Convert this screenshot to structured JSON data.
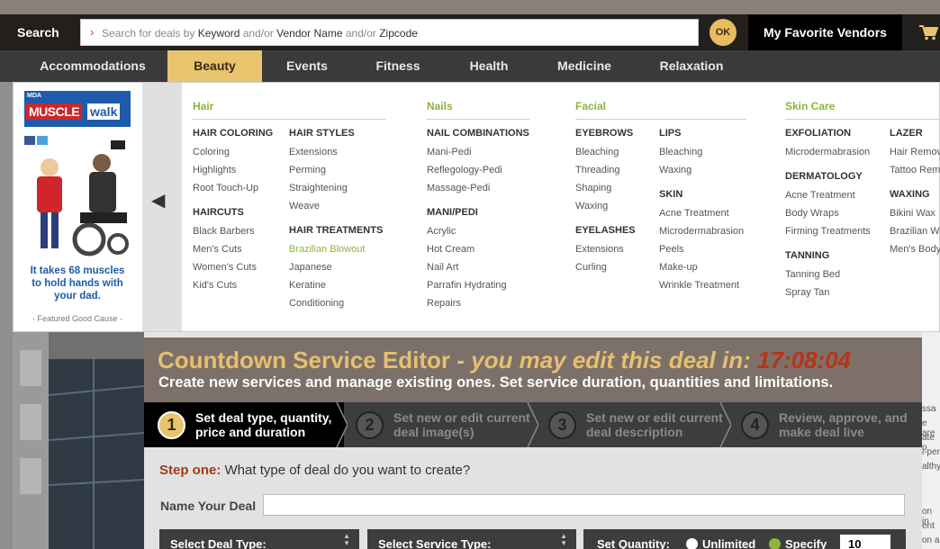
{
  "search": {
    "label": "Search",
    "chevron": "›",
    "placeholder_parts": [
      "Search for deals by ",
      "Keyword",
      " and/or ",
      "Vendor Name",
      " and/or ",
      "Zipcode"
    ],
    "ok_label": "OK",
    "favorites_label": "My Favorite Vendors"
  },
  "nav": {
    "items": [
      {
        "label": "Accommodations",
        "active": false
      },
      {
        "label": "Beauty",
        "active": true
      },
      {
        "label": "Events",
        "active": false
      },
      {
        "label": "Fitness",
        "active": false
      },
      {
        "label": "Health",
        "active": false
      },
      {
        "label": "Medicine",
        "active": false
      },
      {
        "label": "Relaxation",
        "active": false
      }
    ]
  },
  "ad": {
    "org": "MDA",
    "brand_a": "MUSCLE",
    "brand_b": "walk",
    "text": "It takes 68 muscles to hold hands with your dad.",
    "cause": "- Featured Good Cause -"
  },
  "menu": {
    "hair": {
      "title": "Hair",
      "coloring_title": "HAIR COLORING",
      "coloring": [
        "Coloring",
        "Highlights",
        "Root Touch-Up"
      ],
      "haircuts_title": "HAIRCUTS",
      "haircuts": [
        "Black Barbers",
        "Men's Cuts",
        "Women's Cuts",
        "Kid's Cuts"
      ],
      "styles_title": "HAIR STYLES",
      "styles": [
        "Extensions",
        "Perming",
        "Straightening",
        "Weave"
      ],
      "treatments_title": "HAIR TREATMENTS",
      "treatments": [
        "Brazilian Blowout",
        "Japanese",
        "Keratine",
        "Conditioning"
      ]
    },
    "nails": {
      "title": "Nails",
      "combos_title": "NAIL COMBINATIONS",
      "combos": [
        "Mani-Pedi",
        "Reflegology-Pedi",
        "Massage-Pedi"
      ],
      "manipedi_title": "MANI/PEDI",
      "manipedi": [
        "Acrylic",
        "Hot Cream",
        "Nail Art",
        "Parrafin Hydrating",
        "Repairs"
      ]
    },
    "facial": {
      "title": "Facial",
      "eyebrows_title": "EYEBROWS",
      "eyebrows": [
        "Bleaching",
        "Threading",
        "Shaping",
        "Waxing"
      ],
      "eyelashes_title": "EYELASHES",
      "eyelashes": [
        "Extensions",
        "Curling"
      ],
      "lips_title": "LIPS",
      "lips": [
        "Bleaching",
        "Waxing"
      ],
      "skin_title": "SKIN",
      "skin": [
        "Acne Treatment",
        "Microdermabrasion",
        "Peels",
        "Make-up",
        "Wrinkle Treatment"
      ]
    },
    "skincare": {
      "title": "Skin Care",
      "exfoliation_title": "EXFOLIATION",
      "exfoliation": [
        "Microdermabrasion"
      ],
      "derm_title": "DERMATOLOGY",
      "derm": [
        "Acne Treatment",
        "Body Wraps",
        "Firming Treatments"
      ],
      "tanning_title": "TANNING",
      "tanning": [
        "Tanning Bed",
        "Spray Tan"
      ],
      "lazer_title": "LAZER",
      "lazer": [
        "Hair Remov",
        "Tattoo Rem"
      ],
      "waxing_title": "WAXING",
      "waxing": [
        "Bikini Wax",
        "Brazilian W",
        "Men's Body"
      ]
    }
  },
  "editor": {
    "title_a": "Countdown Service Editor - ",
    "title_b": "you may edit this deal in: ",
    "timer": "17:08:04",
    "subtitle": "Create new services and manage existing ones. Set service duration, quantities and limitations.",
    "steps": [
      {
        "num": "1",
        "line1": "Set deal type, quantity,",
        "line2": "price and duration",
        "active": true
      },
      {
        "num": "2",
        "line1": "Set new or edit current",
        "line2": "deal image(s)",
        "active": false
      },
      {
        "num": "3",
        "line1": "Set new or edit current",
        "line2": "deal description",
        "active": false
      },
      {
        "num": "4",
        "line1": "Review, approve, and",
        "line2": "make deal live",
        "active": false
      }
    ],
    "step_one_label": "Step one:",
    "step_one_question": " What type of deal do you want to create?",
    "name_label": "Name Your Deal",
    "deal_type_label": "Select Deal Type:",
    "service_type_label": "Select Service Type:",
    "quantity_label": "Set Quantity:",
    "unlimited_label": "Unlimited",
    "specify_label": "Specify",
    "quantity_value": "10"
  },
  "background": {
    "right_fragments": [
      "ssa",
      "e are",
      "ate o",
      "i-per",
      "althy",
      "on in",
      "ent",
      "on a",
      "mpe"
    ]
  },
  "colors": {
    "accent_gold": "#e8c46e",
    "menu_green": "#8db43e",
    "timer_red": "#b8331a",
    "dark_bar": "#231f1c"
  }
}
